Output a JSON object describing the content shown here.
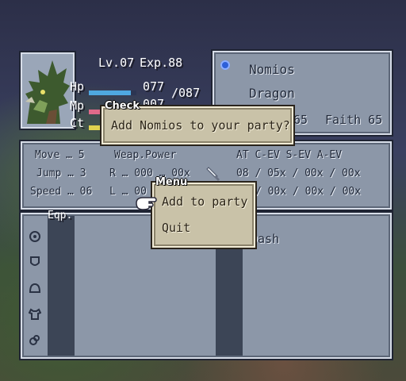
{
  "unit": {
    "level": "Lv.07",
    "exp": "Exp.88",
    "hp_label": "Hp",
    "hp_value": "077",
    "hp_max": "/087",
    "mp_label": "Mp",
    "mp_value": "007",
    "ct_label": "Ct",
    "hp_fraction": 0.88,
    "mp_fraction": 0.3,
    "ct_fraction": 0.5
  },
  "info": {
    "name": "Nomios",
    "job": "Dragon",
    "brave_partial": "65",
    "faith": "Faith 65"
  },
  "stats": {
    "move": "Move … 5",
    "jump": "Jump … 3",
    "speed": "Speed … 06",
    "weap_power": "Weap.Power",
    "r_row": "R … 000 … 00x",
    "l_row": "L … 00",
    "headers": "AT C-EV S-EV A-EV",
    "row1": "08 / 05x / 00x / 00x",
    "row2": "/ 00x / 00x / 00x"
  },
  "equip": {
    "header": "Eqp.",
    "dash": "Dash"
  },
  "check_dialog": {
    "tag": "Check",
    "text": "Add Nomios to your party?"
  },
  "menu": {
    "tag": "Menu",
    "items": [
      "Add to party",
      "Quit"
    ]
  },
  "colors": {
    "panel": "#8c97a8",
    "dialog": "#c9c2a8",
    "hp_bar": "#4fa8e0",
    "mp_bar": "#e06a8a",
    "ct_bar": "#e0d24f"
  },
  "icons": [
    "dragon-portrait",
    "gem-icon",
    "hand-cursor-icon",
    "sword-icon",
    "helmet-icon",
    "armor-icon",
    "accessory-icon"
  ]
}
